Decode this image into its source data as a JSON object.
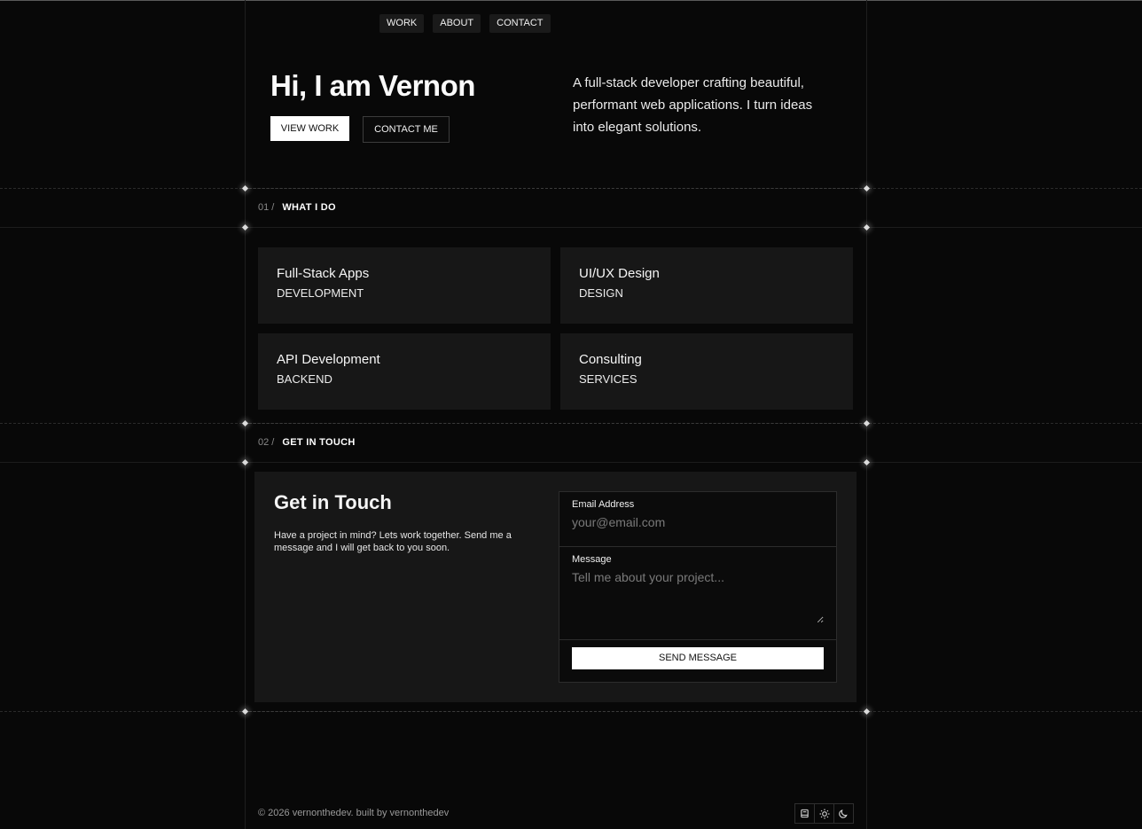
{
  "nav": {
    "items": [
      {
        "label": "WORK"
      },
      {
        "label": "ABOUT"
      },
      {
        "label": "CONTACT"
      }
    ]
  },
  "hero": {
    "title": "Hi, I am Vernon",
    "primary_button": "VIEW WORK",
    "secondary_button": "CONTACT ME",
    "description": "A full-stack developer crafting beautiful, performant web applications. I turn ideas into elegant solutions."
  },
  "sections": {
    "services": {
      "number": "01 /",
      "title": "WHAT I DO"
    },
    "contact": {
      "number": "02 /",
      "title": "GET IN TOUCH"
    }
  },
  "services": [
    {
      "title": "Full-Stack Apps",
      "category": "DEVELOPMENT"
    },
    {
      "title": "UI/UX Design",
      "category": "DESIGN"
    },
    {
      "title": "API Development",
      "category": "BACKEND"
    },
    {
      "title": "Consulting",
      "category": "SERVICES"
    }
  ],
  "contact": {
    "title": "Get in Touch",
    "text": "Have a project in mind? Lets work together. Send me a message and I will get back to you soon.",
    "email_label": "Email Address",
    "email_placeholder": "your@email.com",
    "message_label": "Message",
    "message_placeholder": "Tell me about your project...",
    "send_label": "SEND MESSAGE"
  },
  "footer": {
    "copyright": "© 2026 vernonthedev. built by vernonthedev",
    "theme_icons": [
      "book-icon",
      "sun-icon",
      "moon-icon"
    ]
  },
  "colors": {
    "background": "#080808",
    "card": "#171717",
    "text": "#f2f2f2",
    "accent": "#ffffff"
  }
}
